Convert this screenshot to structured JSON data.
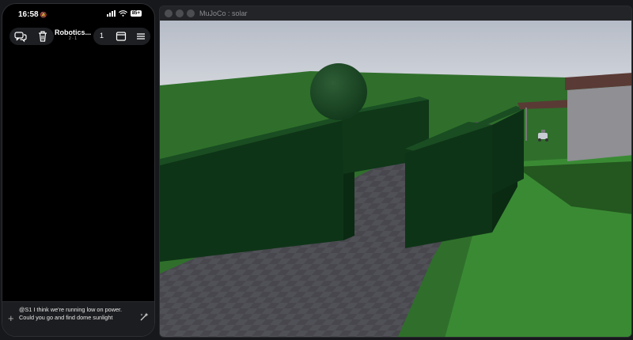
{
  "phone": {
    "status": {
      "time": "16:58",
      "battery": "85+"
    },
    "header": {
      "title": "Robotics...",
      "subtitle": "2 · 1",
      "tab_count": "1"
    },
    "composer": {
      "message": "@S1 I think we're running low on power. Could you go and find dome sunlight"
    }
  },
  "window": {
    "title": "MuJoCo : solar"
  },
  "icons": {
    "mute": "bell-slash-icon",
    "chats": "chat-bubbles-icon",
    "trash": "trash-icon",
    "tabs": "browser-window-icon",
    "menu": "hamburger-menu-icon",
    "plus": "plus-icon",
    "send": "sparkle-send-icon"
  },
  "colors": {
    "sky": "#c8ccd4",
    "grass": "#2f6f2b",
    "hedge": "#0f3a19",
    "road": "#46464c"
  }
}
